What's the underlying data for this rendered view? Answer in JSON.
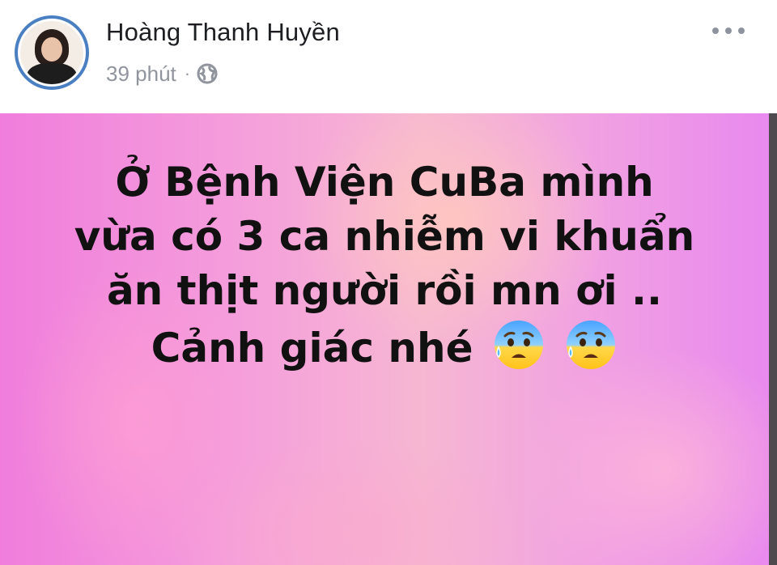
{
  "post": {
    "author": {
      "name": "Hoàng Thanh Huyền",
      "avatar_icon": "profile-photo"
    },
    "meta": {
      "time": "39 phút",
      "separator": "·",
      "audience_icon": "globe-icon"
    },
    "more_icon": "more-options-icon"
  },
  "content": {
    "background": {
      "colors": [
        "#f07ddc",
        "#f6b7d2",
        "#e889ee"
      ]
    },
    "lines": [
      "Ở Bệnh Viện CuBa mình",
      "vừa có 3 ca nhiễm vi khuẩn",
      "ăn thịt người rồi mn ơi ..",
      "Cảnh giác nhé"
    ],
    "emoji": [
      "anxious-face-with-sweat",
      "anxious-face-with-sweat"
    ]
  }
}
